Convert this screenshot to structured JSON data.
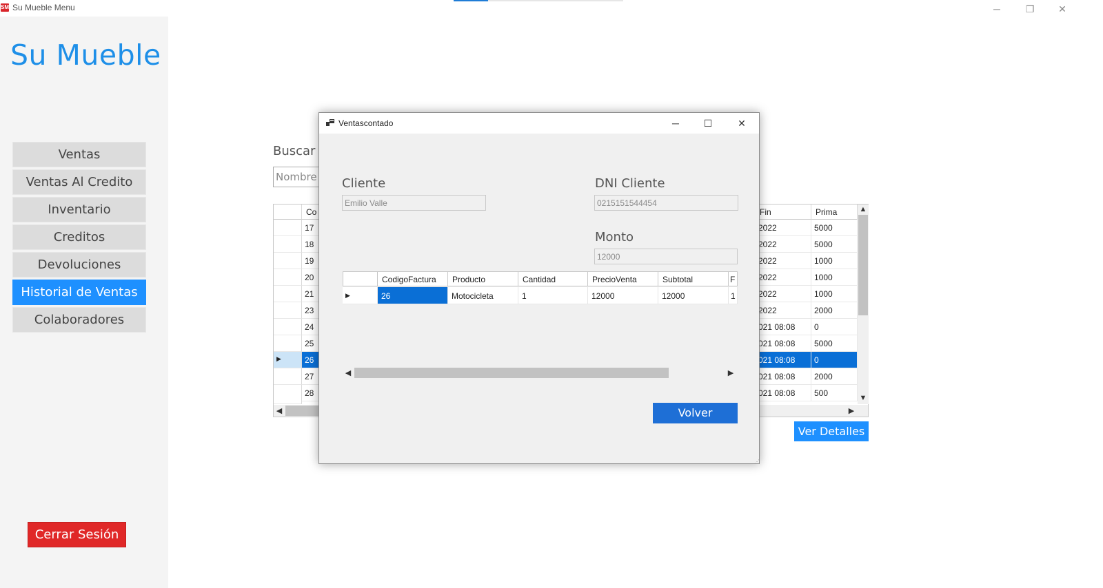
{
  "window": {
    "title": "Su Mueble Menu",
    "app_icon_text": "SM",
    "controls": {
      "minimize": "─",
      "restore": "❐",
      "close": "✕"
    }
  },
  "sidebar": {
    "brand": "Su Mueble",
    "items": [
      {
        "label": "Ventas",
        "active": false
      },
      {
        "label": "Ventas Al Credito",
        "active": false
      },
      {
        "label": "Inventario",
        "active": false
      },
      {
        "label": "Creditos",
        "active": false
      },
      {
        "label": "Devoluciones",
        "active": false
      },
      {
        "label": "Historial de Ventas",
        "active": true
      },
      {
        "label": "Colaboradores",
        "active": false
      }
    ],
    "logout_label": "Cerrar Sesión"
  },
  "history": {
    "search_label": "Buscar C",
    "search_placeholder": "Nombre d",
    "columns": {
      "code": "Co",
      "fin": "Fin",
      "prima": "Prima"
    },
    "rows": [
      {
        "code": "17",
        "fin": "2022",
        "prima": "5000"
      },
      {
        "code": "18",
        "fin": "2022",
        "prima": "5000"
      },
      {
        "code": "19",
        "fin": "2022",
        "prima": "1000"
      },
      {
        "code": "20",
        "fin": "2022",
        "prima": "1000"
      },
      {
        "code": "21",
        "fin": "2022",
        "prima": "1000"
      },
      {
        "code": "23",
        "fin": "2022",
        "prima": "2000"
      },
      {
        "code": "24",
        "fin": "021 08:08",
        "prima": "0"
      },
      {
        "code": "25",
        "fin": "021 08:08",
        "prima": "5000"
      },
      {
        "code": "26",
        "fin": "021 08:08",
        "prima": "0"
      },
      {
        "code": "27",
        "fin": "021 08:08",
        "prima": "2000"
      },
      {
        "code": "28",
        "fin": "021 08:08",
        "prima": "500"
      }
    ],
    "selected_row_index": 8,
    "details_button": "Ver Detalles"
  },
  "dialog": {
    "title": "Ventascontado",
    "controls": {
      "minimize": "─",
      "maximize": "☐",
      "close": "✕"
    },
    "cliente_label": "Cliente",
    "cliente_value": "Emilio Valle",
    "dni_label": "DNI Cliente",
    "dni_value": "0215151544454",
    "monto_label": "Monto",
    "monto_value": "12000",
    "grid": {
      "columns": [
        "CodigoFactura",
        "Producto",
        "Cantidad",
        "PrecioVenta",
        "Subtotal",
        "F"
      ],
      "rows": [
        [
          "26",
          "Motocicleta",
          "1",
          "12000",
          "12000",
          "1"
        ]
      ]
    },
    "back_button": "Volver"
  }
}
